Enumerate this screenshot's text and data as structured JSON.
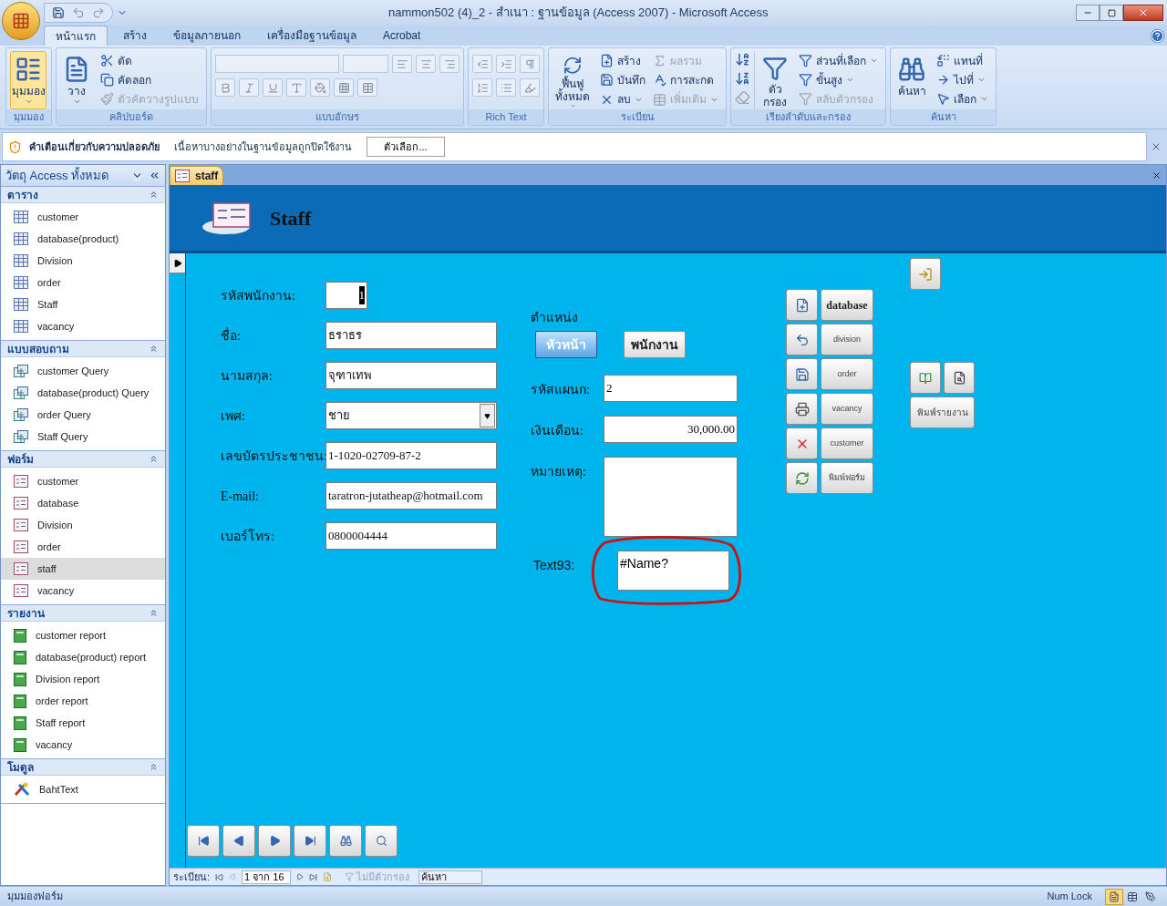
{
  "window": {
    "title": "nammon502 (4)_2 - สำเนา : ฐานข้อมูล (Access 2007) - Microsoft Access"
  },
  "ribbon_tabs": [
    {
      "label": "หน้าแรก",
      "selected": true
    },
    {
      "label": "สร้าง",
      "selected": false
    },
    {
      "label": "ข้อมูลภายนอก",
      "selected": false
    },
    {
      "label": "เครื่องมือฐานข้อมูล",
      "selected": false
    },
    {
      "label": "Acrobat",
      "selected": false
    }
  ],
  "ribbon_groups": [
    {
      "kind": "view",
      "label": "มุมมอง",
      "buttons": [
        {
          "label": "มุมมอง",
          "highlighted": true,
          "disabled": false,
          "dropdown": true
        }
      ]
    },
    {
      "kind": "clipboard",
      "label": "คลิปบอร์ด",
      "buttons": [
        {
          "label": "วาง",
          "disabled": false,
          "dropdown": true
        },
        {
          "label": "ตัด",
          "disabled": false,
          "dropdown": false
        },
        {
          "label": "คัดลอก",
          "disabled": false,
          "dropdown": false
        },
        {
          "label": "ตัวคัดวางรูปแบบ",
          "disabled": true,
          "dropdown": false
        }
      ]
    },
    {
      "kind": "font",
      "label": "แบบอักษร"
    },
    {
      "kind": "richtext",
      "label": "Rich Text"
    },
    {
      "kind": "records",
      "label": "ระเบียน",
      "buttons": [
        {
          "label": "ฟื้นฟู\nทั้งหมด",
          "disabled": false,
          "dropdown": true
        },
        {
          "label": "สร้าง",
          "disabled": false,
          "dropdown": false
        },
        {
          "label": "บันทึก",
          "disabled": false,
          "dropdown": false
        },
        {
          "label": "ลบ",
          "disabled": false,
          "dropdown": true
        },
        {
          "label": "ผลรวม",
          "disabled": true,
          "dropdown": false
        },
        {
          "label": "การสะกด",
          "disabled": false,
          "dropdown": false
        },
        {
          "label": "เพิ่มเติม",
          "disabled": true,
          "dropdown": true
        }
      ]
    },
    {
      "kind": "sort",
      "label": "เรียงลำดับและกรอง",
      "buttons": [
        {
          "label": "ตัว\nกรอง",
          "disabled": false,
          "dropdown": false
        },
        {
          "label": "ส่วนที่เลือก",
          "disabled": false,
          "dropdown": true
        },
        {
          "label": "ขั้นสูง",
          "disabled": false,
          "dropdown": true
        },
        {
          "label": "สลับตัวกรอง",
          "disabled": true,
          "dropdown": false
        }
      ]
    },
    {
      "kind": "find",
      "label": "ค้นหา",
      "buttons": [
        {
          "label": "ค้นหา",
          "disabled": false,
          "dropdown": false
        },
        {
          "label": "แทนที่",
          "disabled": false,
          "dropdown": false
        },
        {
          "label": "ไปที่",
          "disabled": false,
          "dropdown": true
        },
        {
          "label": "เลือก",
          "disabled": false,
          "dropdown": true
        }
      ]
    }
  ],
  "security_bar": {
    "title": "คำเตือนเกี่ยวกับความปลอดภัย",
    "message": "เนื้อหาบางอย่างในฐานข้อมูลถูกปิดใช้งาน",
    "button": "ตัวเลือก..."
  },
  "nav_pane": {
    "title": "วัตถุ Access ทั้งหมด",
    "sections": [
      {
        "kind": "table",
        "title": "ตาราง",
        "items": [
          {
            "label": "customer",
            "selected": false
          },
          {
            "label": "database(product)",
            "selected": false
          },
          {
            "label": "Division",
            "selected": false
          },
          {
            "label": "order",
            "selected": false
          },
          {
            "label": "Staff",
            "selected": false
          },
          {
            "label": "vacancy",
            "selected": false
          }
        ]
      },
      {
        "kind": "query",
        "title": "แบบสอบถาม",
        "items": [
          {
            "label": "customer Query",
            "selected": false
          },
          {
            "label": "database(product) Query",
            "selected": false
          },
          {
            "label": "order Query",
            "selected": false
          },
          {
            "label": "Staff Query",
            "selected": false
          }
        ]
      },
      {
        "kind": "form",
        "title": "ฟอร์ม",
        "items": [
          {
            "label": "customer",
            "selected": false
          },
          {
            "label": "database",
            "selected": false
          },
          {
            "label": "Division",
            "selected": false
          },
          {
            "label": "order",
            "selected": false
          },
          {
            "label": "staff",
            "selected": true
          },
          {
            "label": "vacancy",
            "selected": false
          }
        ]
      },
      {
        "kind": "report",
        "title": "รายงาน",
        "items": [
          {
            "label": "customer report",
            "selected": false
          },
          {
            "label": "database(product) report",
            "selected": false
          },
          {
            "label": "Division report",
            "selected": false
          },
          {
            "label": "order report",
            "selected": false
          },
          {
            "label": "Staff report",
            "selected": false
          },
          {
            "label": "vacancy",
            "selected": false
          }
        ]
      },
      {
        "kind": "module",
        "title": "โมดูล",
        "items": [
          {
            "label": "BahtText",
            "selected": false
          }
        ]
      }
    ]
  },
  "document_tab": {
    "label": "staff"
  },
  "form": {
    "title": "Staff",
    "left_fields": [
      {
        "kind": "autonumber",
        "label": "รหัสพนักงาน:",
        "value": "1",
        "focused": true
      },
      {
        "kind": "text",
        "label": "ชื่อ:",
        "value": "ธราธร",
        "focused": false
      },
      {
        "kind": "text",
        "label": "นามสกุล:",
        "value": "จุฑาเทพ",
        "focused": false
      },
      {
        "kind": "combo",
        "label": "เพศ:",
        "value": "ชาย",
        "focused": false
      },
      {
        "kind": "text",
        "label": "เลขบัตรประชาชน:",
        "value": "1-1020-02709-87-2",
        "focused": false
      },
      {
        "kind": "text",
        "label": "E-mail:",
        "value": "taratron-jutatheap@hotmail.com",
        "focused": false
      },
      {
        "kind": "text",
        "label": "เบอร์โทร:",
        "value": "0800004444",
        "focused": false
      }
    ],
    "position_label": "ตำแหน่ง",
    "position_options": [
      {
        "label": "หัวหน้า",
        "selected": true
      },
      {
        "label": "พนักงาน",
        "selected": false
      }
    ],
    "right_fields": [
      {
        "kind": "text",
        "label": "รหัสแผนก:",
        "value": "2",
        "circled": false
      },
      {
        "kind": "number",
        "label": "เงินเดือน:",
        "value": "30,000.00",
        "circled": false
      },
      {
        "kind": "memo",
        "label": "หมายเหตุ:",
        "circled": false
      },
      {
        "kind": "unbound",
        "label": "Text93:",
        "value": "#Name?",
        "circled": true
      }
    ],
    "commands": [
      {
        "kind": "icon"
      },
      {
        "kind": "text",
        "label": "database",
        "bold": true
      },
      {
        "kind": "icon"
      },
      {
        "kind": "text",
        "label": "division",
        "bold": false
      },
      {
        "kind": "icon"
      },
      {
        "kind": "text",
        "label": "order",
        "bold": false
      },
      {
        "kind": "icon"
      },
      {
        "kind": "text",
        "label": "vacancy",
        "bold": false
      },
      {
        "kind": "icon"
      },
      {
        "kind": "text",
        "label": "customer",
        "bold": false
      },
      {
        "kind": "icon"
      },
      {
        "kind": "text",
        "label": "พิมพ์ฟอร์ม",
        "bold": false
      }
    ],
    "report_button": "พิมพ์รายงาน"
  },
  "record_bar": {
    "label": "ระเบียน:",
    "position": "1 จาก 16",
    "filter": "ไม่มีตัวกรอง",
    "filter_disabled": true,
    "search_placeholder": "ค้นหา"
  },
  "status_bar": {
    "mode": "มุมมองฟอร์ม",
    "indicator": "Num Lock",
    "views": [
      {
        "selected": true
      },
      {
        "selected": false
      },
      {
        "selected": false
      }
    ]
  }
}
